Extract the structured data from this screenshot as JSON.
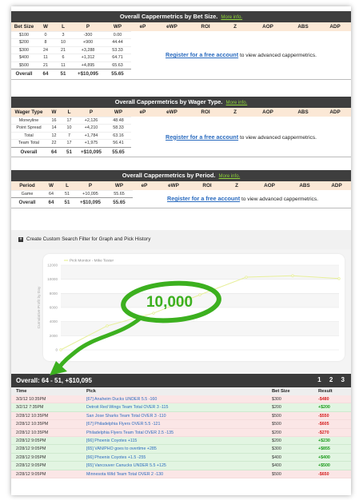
{
  "bet_size": {
    "title": "Overall Cappermetrics by Bet Size.",
    "more": "More info.",
    "headers": [
      "Bet Size",
      "W",
      "L",
      "P",
      "WP",
      "eP",
      "eWP",
      "ROI",
      "Z",
      "AOP",
      "ABS",
      "ADP"
    ],
    "rows": [
      [
        "$100",
        "0",
        "3",
        "-300",
        "0.00"
      ],
      [
        "$200",
        "8",
        "10",
        "+900",
        "44.44"
      ],
      [
        "$300",
        "24",
        "21",
        "+3,288",
        "53.33"
      ],
      [
        "$400",
        "11",
        "6",
        "+1,312",
        "64.71"
      ],
      [
        "$500",
        "21",
        "11",
        "+4,895",
        "65.63"
      ]
    ],
    "total": [
      "Overall",
      "64",
      "51",
      "+$10,095",
      "55.65"
    ],
    "register_link": "Register for a free account",
    "register_text": "to view advanced cappermetrics."
  },
  "wager_type": {
    "title": "Overall Cappermetrics by Wager Type.",
    "more": "More info.",
    "headers": [
      "Wager Type",
      "W",
      "L",
      "P",
      "WP",
      "eP",
      "eWP",
      "ROI",
      "Z",
      "AOP",
      "ABS",
      "ADP"
    ],
    "rows": [
      [
        "Moneyline",
        "16",
        "17",
        "+2,126",
        "48.48"
      ],
      [
        "Point Spread",
        "14",
        "10",
        "+4,210",
        "58.33"
      ],
      [
        "Total",
        "12",
        "7",
        "+1,784",
        "63.16"
      ],
      [
        "Team Total",
        "22",
        "17",
        "+1,975",
        "56.41"
      ]
    ],
    "total": [
      "Overall",
      "64",
      "51",
      "+$10,095",
      "55.65"
    ],
    "register_link": "Register for a free account",
    "register_text": "to view advanced cappermetrics."
  },
  "period": {
    "title": "Overall Cappermetrics by Period.",
    "more": "More info.",
    "headers": [
      "Period",
      "W",
      "L",
      "P",
      "WP",
      "eP",
      "eWP",
      "ROI",
      "Z",
      "AOP",
      "ABS",
      "ADP"
    ],
    "rows": [
      [
        "Game",
        "64",
        "51",
        "+10,095",
        "55.65"
      ]
    ],
    "total": [
      "Overall",
      "64",
      "51",
      "+$10,095",
      "55.65"
    ],
    "register_link": "Register for a free account",
    "register_text": "to view advanced cappermetrics."
  },
  "search_filter": {
    "label": "Create Custom Search Filter for Graph and Pick History"
  },
  "annotation": {
    "callout": "10,000"
  },
  "chart_data": {
    "type": "line",
    "series": [
      {
        "name": "Pick Monitor - Mike Tester",
        "values": [
          0,
          3400,
          5200,
          7800,
          10300,
          10500,
          10100
        ]
      }
    ],
    "x": [
      1,
      2,
      3,
      4,
      5,
      6,
      7
    ],
    "ylabel": "Cumulative Profit by Day",
    "yticks": [
      "0",
      "2000",
      "4000",
      "6000",
      "8000",
      "10000",
      "12000"
    ],
    "ylim": [
      0,
      12000
    ],
    "grid": true,
    "legend": "top-left",
    "line_color": "#e7ef9a"
  },
  "overall_bar": {
    "title": "Overall: 64 - 51, +$10,095",
    "pages": [
      "1",
      "2",
      "3"
    ]
  },
  "picks_headers": {
    "time": "Time",
    "pick": "Pick",
    "bet": "Bet Size",
    "result": "Result"
  },
  "picks": [
    {
      "time": "3/3/12 10:35PM",
      "pick": "[67] Anaheim Ducks UNDER 5.5 -160",
      "bet": "$300",
      "result": "-$480",
      "status": "loss"
    },
    {
      "time": "3/2/12 7:35PM",
      "pick": "Detroit Red Wings Team Total OVER 3 -115",
      "bet": "$200",
      "result": "+$200",
      "status": "win"
    },
    {
      "time": "2/28/12 10:35PM",
      "pick": "San Jose Sharks Team Total OVER 3 -110",
      "bet": "$500",
      "result": "-$550",
      "status": "loss"
    },
    {
      "time": "2/28/12 10:35PM",
      "pick": "[67] Philadelphia Flyers OVER 5.5 -121",
      "bet": "$500",
      "result": "-$605",
      "status": "loss"
    },
    {
      "time": "2/28/12 10:35PM",
      "pick": "Philadelphia Flyers Team Total OVER 2.5 -135",
      "bet": "$200",
      "result": "-$270",
      "status": "loss"
    },
    {
      "time": "2/28/12 9:05PM",
      "pick": "[66] Phoenix Coyotes +115",
      "bet": "$200",
      "result": "+$230",
      "status": "win"
    },
    {
      "time": "2/28/12 9:05PM",
      "pick": "[65] VAN/PHO goes to overtime +285",
      "bet": "$300",
      "result": "+$855",
      "status": "win"
    },
    {
      "time": "2/28/12 9:05PM",
      "pick": "[66] Phoenix Coyotes +1.5 -255",
      "bet": "$400",
      "result": "+$400",
      "status": "win"
    },
    {
      "time": "2/28/12 9:05PM",
      "pick": "[65] Vancouver Canucks UNDER 5.5 +125",
      "bet": "$400",
      "result": "+$500",
      "status": "win"
    },
    {
      "time": "2/28/12 9:05PM",
      "pick": "Minnesota Wild Team Total OVER 2 -130",
      "bet": "$500",
      "result": "-$650",
      "status": "loss"
    }
  ],
  "colors": {
    "header_bg": "#3e3e3e",
    "more_link": "#8fd43a",
    "th_bg": "#fbe8d6",
    "link": "#2a6bbf",
    "callout": "#3cb01f",
    "win_bg": "#e2f5e2",
    "loss_bg": "#fbe6e6"
  }
}
